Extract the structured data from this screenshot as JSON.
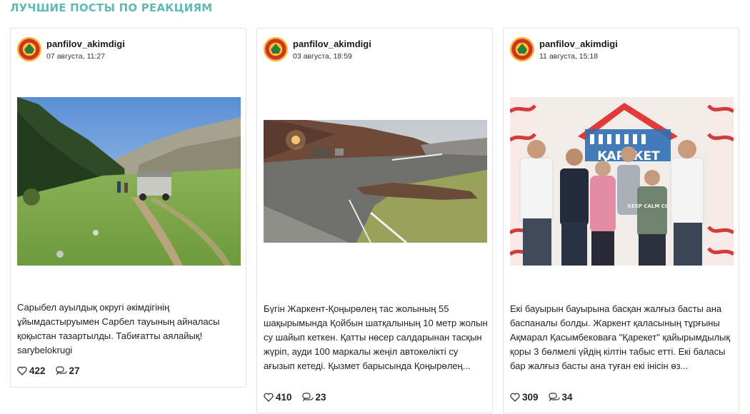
{
  "section": {
    "title": "ЛУЧШИЕ ПОСТЫ ПО РЕАКЦИЯМ"
  },
  "posts": [
    {
      "username": "panfilov_akimdigi",
      "date": "07 августа, 11:27",
      "caption": "Сарыбел ауылдық округі әкімдігінің ұйымдастыруымен Сарбел тауының айналасы қоқыстан тазартылды. Табиғатты аялайық! sarybelokrugi",
      "likes": "422",
      "comments": "27"
    },
    {
      "username": "panfilov_akimdigi",
      "date": "03 августа, 18:59",
      "caption": "Бүгін Жаркент-Қоңырөлең тас жолының 55 шақырымында Қойбын шатқалының 10 метр жолын су шайып кеткен. Қатты нөсер салдарынан тасқын жүріп, ауди 100 маркалы жеңіл автокөлікті су ағызып кетеді. Қызмет барысында Қоңырөлең...",
      "likes": "410",
      "comments": "23"
    },
    {
      "username": "panfilov_akimdigi",
      "date": "11 августа, 15:18",
      "caption": "Екі бауырын бауырына басқан жалғыз басты ана баспаналы болды. Жаркент қаласының тұрғыны Ақмарал Қасымбековаға \"Қарекет\" қайырымдылық қоры 3 бөлмелі үйдің кілтін табыс етті. Екі баласы бар жалғыз басты ана туған екі інісін өз...",
      "likes": "309",
      "comments": "34",
      "banner_text": "ҚАРЕКЕТ",
      "shirt_text": "KEEP CALM COOL"
    }
  ],
  "icons": {
    "like": "heart-outline-icon",
    "comment": "comments-outline-icon"
  },
  "colors": {
    "title": "#5fb9b5",
    "banner": "#e23a3a"
  }
}
